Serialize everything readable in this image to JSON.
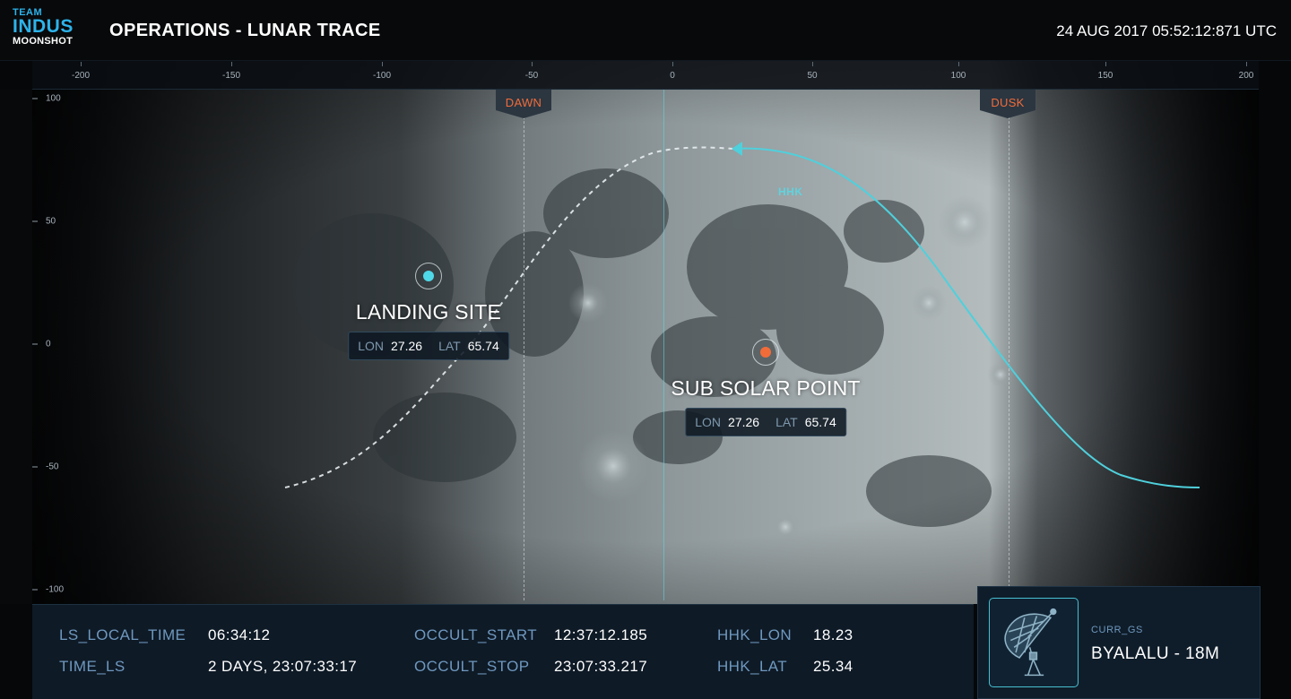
{
  "header": {
    "logo_line1": "TEAM",
    "logo_line2": "INDUS",
    "logo_line3": "MOONSHOT",
    "title": "OPERATIONS - LUNAR TRACE",
    "timestamp": "24 AUG 2017 05:52:12:871 UTC"
  },
  "map": {
    "x_ticks": [
      "-200",
      "-150",
      "-100",
      "-50",
      "0",
      "50",
      "100",
      "150",
      "200"
    ],
    "y_ticks": [
      "100",
      "50",
      "0",
      "-50",
      "-100"
    ],
    "dawn_label": "DAWN",
    "dusk_label": "DUSK",
    "trace_label": "HHK",
    "trace_color": "#4fd0dc",
    "landing_site": {
      "title": "LANDING SITE",
      "lon_label": "LON",
      "lon_value": "27.26",
      "lat_label": "LAT",
      "lat_value": "65.74",
      "marker_color": "#4fd8e8"
    },
    "sub_solar_point": {
      "title": "SUB SOLAR POINT",
      "lon_label": "LON",
      "lon_value": "27.26",
      "lat_label": "LAT",
      "lat_value": "65.74",
      "marker_color": "#f26c3a"
    }
  },
  "telemetry": {
    "ls_local_time_label": "LS_LOCAL_TIME",
    "ls_local_time_value": "06:34:12",
    "time_ls_label": "TIME_LS",
    "time_ls_value": "2 DAYS, 23:07:33:17",
    "occult_start_label": "OCCULT_START",
    "occult_start_value": "12:37:12.185",
    "occult_stop_label": "OCCULT_STOP",
    "occult_stop_value": "23:07:33.217",
    "hhk_lon_label": "HHK_LON",
    "hhk_lon_value": "18.23",
    "hhk_lat_label": "HHK_LAT",
    "hhk_lat_value": "25.34"
  },
  "ground_station": {
    "label": "CURR_GS",
    "value": "BYALALU - 18M",
    "icon": "satellite-dish-icon"
  },
  "colors": {
    "accent": "#2db3ea",
    "trace": "#4fd0dc",
    "sun": "#f26c3a",
    "panel": "#0e1a26"
  }
}
